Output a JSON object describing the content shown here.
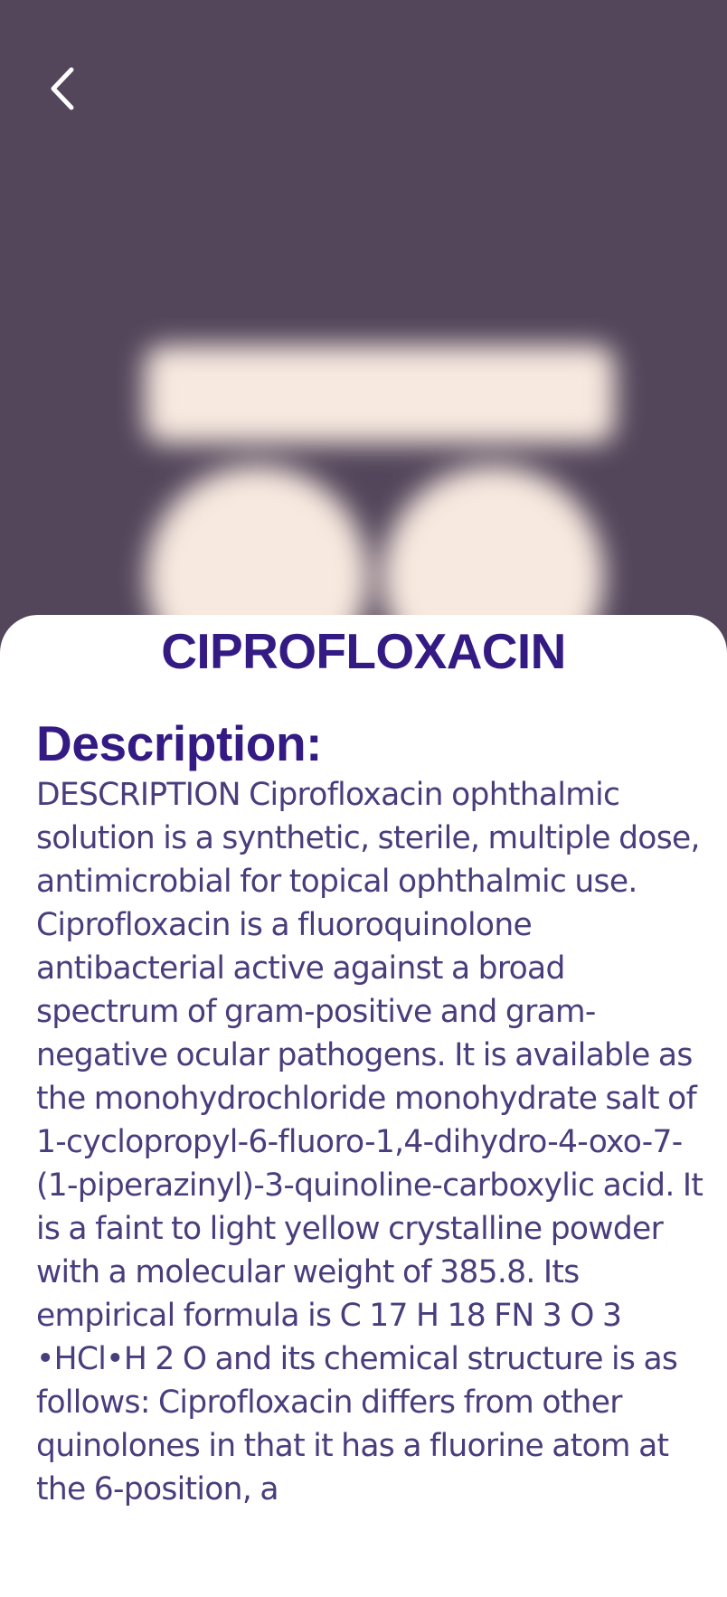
{
  "header": {
    "back_icon": "chevron-left-icon",
    "image_semantic": "blurred pill image"
  },
  "drug": {
    "name": "CIPROFLOXACIN"
  },
  "description": {
    "heading": "Description:",
    "text": "DESCRIPTION Ciprofloxacin ophthalmic solution is a synthetic, sterile, multiple dose, antimicrobial for topical ophthalmic use. Ciprofloxacin is a fluoroquinolone antibacterial active against a broad spectrum of gram-positive and gram-negative ocular pathogens. It is available as the monohydrochloride monohydrate salt of 1-cyclopropyl-6-fluoro-1,4-dihydro-4-oxo-7-(1-piperazinyl)-3-quinoline-carboxylic acid. It is a faint to light yellow crystalline powder with a molecular weight of 385.8. Its empirical formula is C 17 H 18 FN 3 O 3 •HCl•H 2 O and its chemical structure is as follows: Ciprofloxacin differs from other quinolones in that it has a fluorine atom at the 6-position, a"
  },
  "colors": {
    "hero_background": "#53465b",
    "title_color": "#341a83",
    "text_color": "#4a3d7c",
    "sheet_background": "#ffffff",
    "pill_color": "#f7e9df"
  }
}
